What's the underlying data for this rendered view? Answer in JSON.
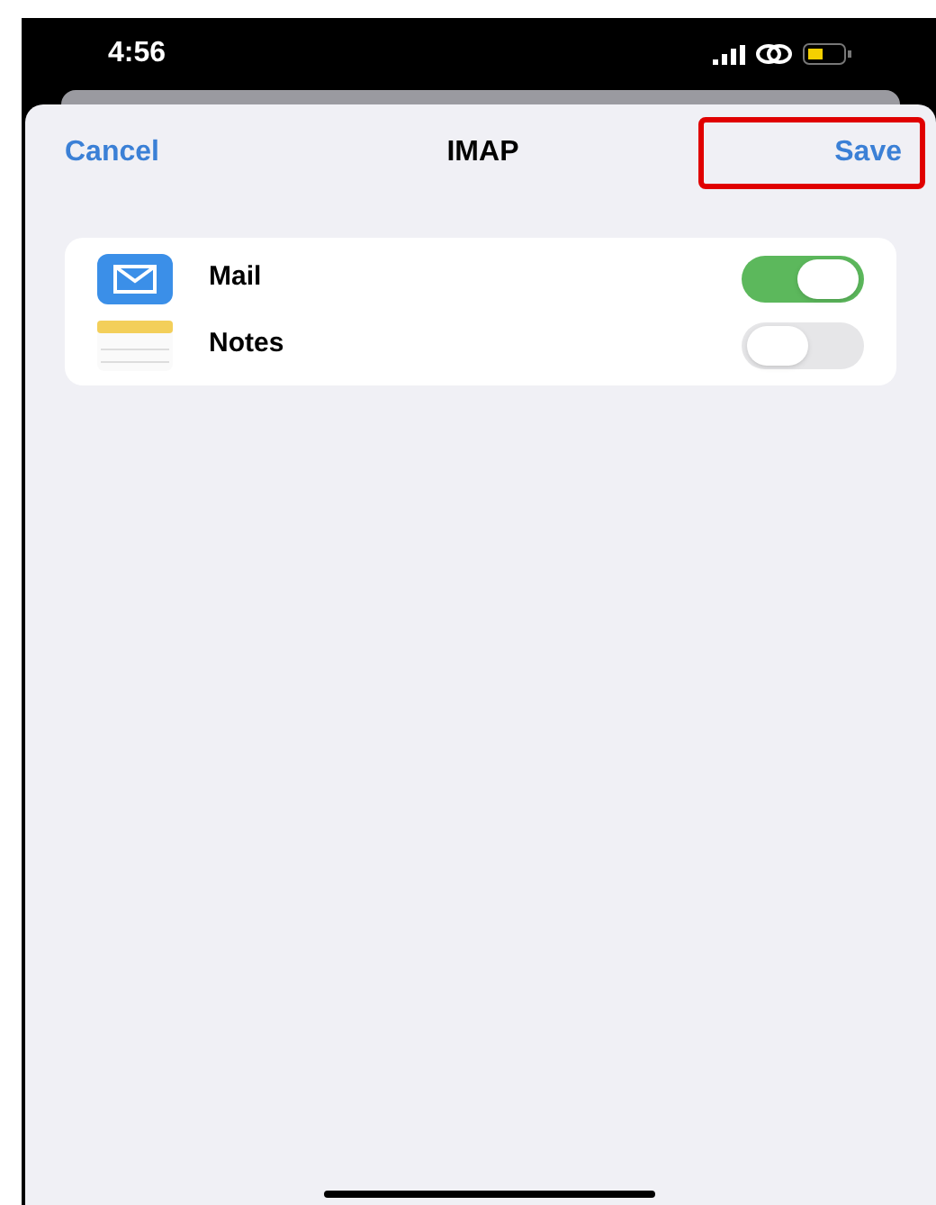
{
  "status_bar": {
    "time": "4:56"
  },
  "nav": {
    "cancel": "Cancel",
    "title": "IMAP",
    "save": "Save",
    "save_highlighted": true
  },
  "toggles": [
    {
      "kind": "mail",
      "label": "Mail",
      "on": true
    },
    {
      "kind": "notes",
      "label": "Notes",
      "on": false
    }
  ]
}
